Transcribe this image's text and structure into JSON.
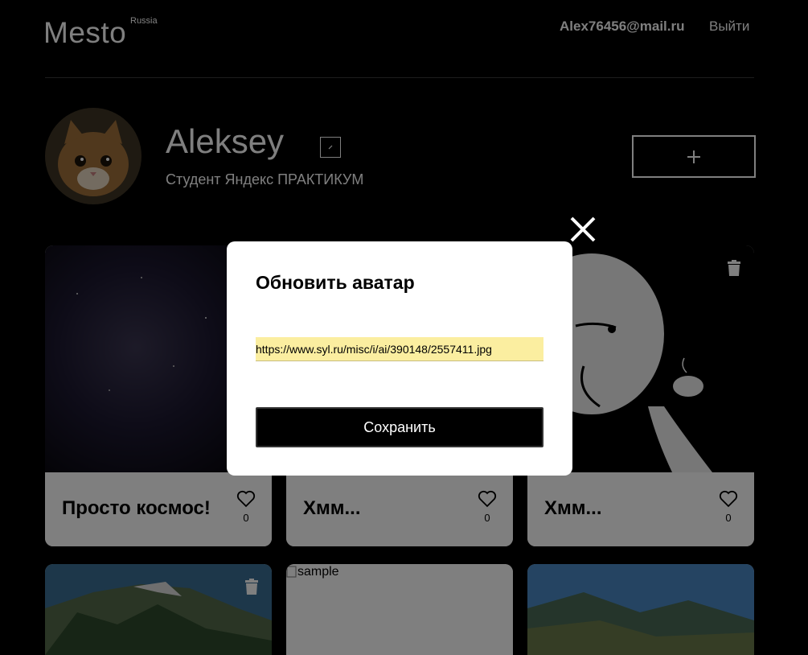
{
  "header": {
    "logo": "Mesto",
    "logo_sup": "Russia",
    "email": "Alex76456@mail.ru",
    "logout": "Выйти"
  },
  "profile": {
    "name": "Aleksey",
    "about": "Студент Яндекс ПРАКТИКУМ",
    "add_label": "+"
  },
  "cards": [
    {
      "title": "Просто космос!",
      "likes": "0",
      "image": "space"
    },
    {
      "title": "Хмм...",
      "likes": "0",
      "image": "cartoon-thinking"
    },
    {
      "title": "Хмм...",
      "likes": "0",
      "image": "cartoon-thinking-coffee"
    },
    {
      "title": "",
      "likes": "",
      "image": "mountains"
    },
    {
      "title": "",
      "likes": "",
      "image": "broken",
      "alt": "sample"
    },
    {
      "title": "",
      "likes": "",
      "image": "mountain-valley"
    }
  ],
  "popup": {
    "title": "Обновить аватар",
    "input_value": "https://www.syl.ru/misc/i/ai/390148/2557411.jpg",
    "save_label": "Сохранить"
  },
  "colors": {
    "background": "#000000",
    "input_highlight": "#fbeea0",
    "card": "#ffffff"
  }
}
